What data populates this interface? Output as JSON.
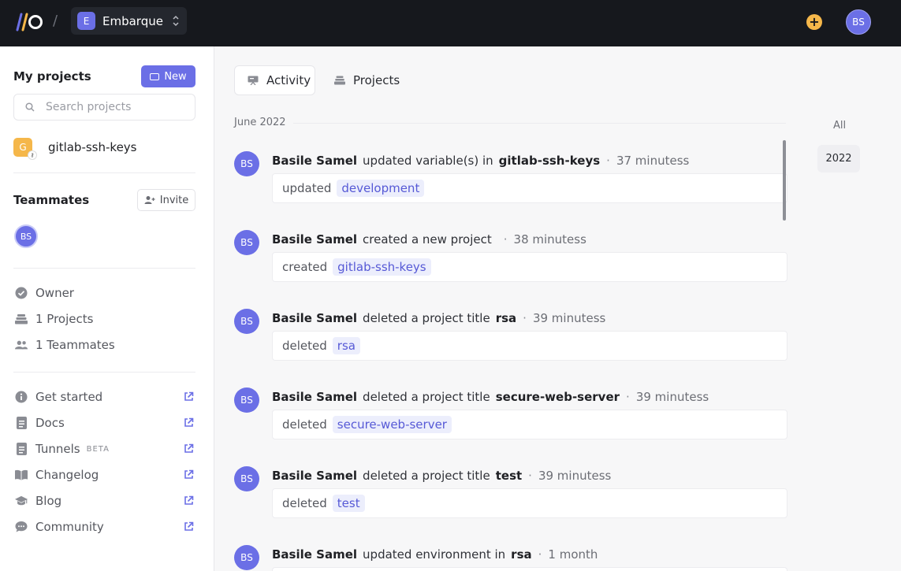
{
  "topbar": {
    "workspace_initial": "E",
    "workspace_name": "Embarque",
    "avatar_initials": "BS"
  },
  "sidebar": {
    "my_projects_title": "My projects",
    "new_button": "New",
    "search_placeholder": "Search projects",
    "projects": [
      {
        "initial": "G",
        "name": "gitlab-ssh-keys"
      }
    ],
    "teammates_title": "Teammates",
    "invite_button": "Invite",
    "teammate_initials": "BS",
    "stats": {
      "role": "Owner",
      "projects": "1 Projects",
      "teammates": "1 Teammates"
    },
    "links": [
      {
        "label": "Get started",
        "icon": "info-icon"
      },
      {
        "label": "Docs",
        "icon": "document-icon"
      },
      {
        "label": "Tunnels",
        "badge": "BETA",
        "icon": "document-icon"
      },
      {
        "label": "Changelog",
        "icon": "book-icon"
      },
      {
        "label": "Blog",
        "icon": "graduation-cap-icon"
      },
      {
        "label": "Community",
        "icon": "chat-icon"
      }
    ]
  },
  "tabs": {
    "activity": "Activity",
    "projects": "Projects"
  },
  "timeline": {
    "month": "June 2022",
    "filter_all": "All",
    "year": "2022"
  },
  "activities": [
    {
      "initials": "BS",
      "user": "Basile Samel",
      "action": "updated variable(s) in",
      "target": "gitlab-ssh-keys",
      "time": "37 minutess",
      "verb": "updated",
      "chip": "development"
    },
    {
      "initials": "BS",
      "user": "Basile Samel",
      "action": "created a new project",
      "target": "",
      "time": "38 minutess",
      "verb": "created",
      "chip": "gitlab-ssh-keys"
    },
    {
      "initials": "BS",
      "user": "Basile Samel",
      "action": "deleted a project title",
      "target": "rsa",
      "time": "39 minutess",
      "verb": "deleted",
      "chip": "rsa"
    },
    {
      "initials": "BS",
      "user": "Basile Samel",
      "action": "deleted a project title",
      "target": "secure-web-server",
      "time": "39 minutess",
      "verb": "deleted",
      "chip": "secure-web-server"
    },
    {
      "initials": "BS",
      "user": "Basile Samel",
      "action": "deleted a project title",
      "target": "test",
      "time": "39 minutess",
      "verb": "deleted",
      "chip": "test"
    },
    {
      "initials": "BS",
      "user": "Basile Samel",
      "action": "updated environment in",
      "target": "rsa",
      "time": "1 month",
      "verb": "",
      "chip": ""
    }
  ],
  "colors": {
    "accent": "#6b6fe6",
    "topbar": "#16181d",
    "plus": "#f5b74a"
  }
}
